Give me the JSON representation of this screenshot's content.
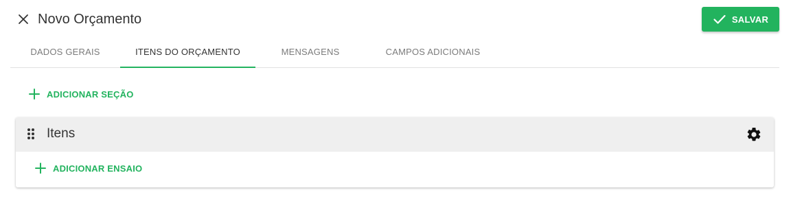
{
  "header": {
    "title": "Novo Orçamento",
    "save_label": "SALVAR"
  },
  "tabs": [
    {
      "label": "DADOS GERAIS",
      "active": false
    },
    {
      "label": "ITENS DO ORÇAMENTO",
      "active": true
    },
    {
      "label": "MENSAGENS",
      "active": false
    },
    {
      "label": "CAMPOS ADICIONAIS",
      "active": false
    }
  ],
  "main": {
    "add_section_label": "ADICIONAR SEÇÃO",
    "section": {
      "title": "Itens",
      "add_test_label": "ADICIONAR ENSAIO"
    }
  },
  "icons": {
    "close": "close-icon",
    "check": "check-icon",
    "plus": "plus-icon",
    "drag": "drag-handle-icon",
    "settings": "gear-icon"
  },
  "colors": {
    "accent": "#22b35e",
    "text": "#333333",
    "muted": "#7b7b7b"
  }
}
